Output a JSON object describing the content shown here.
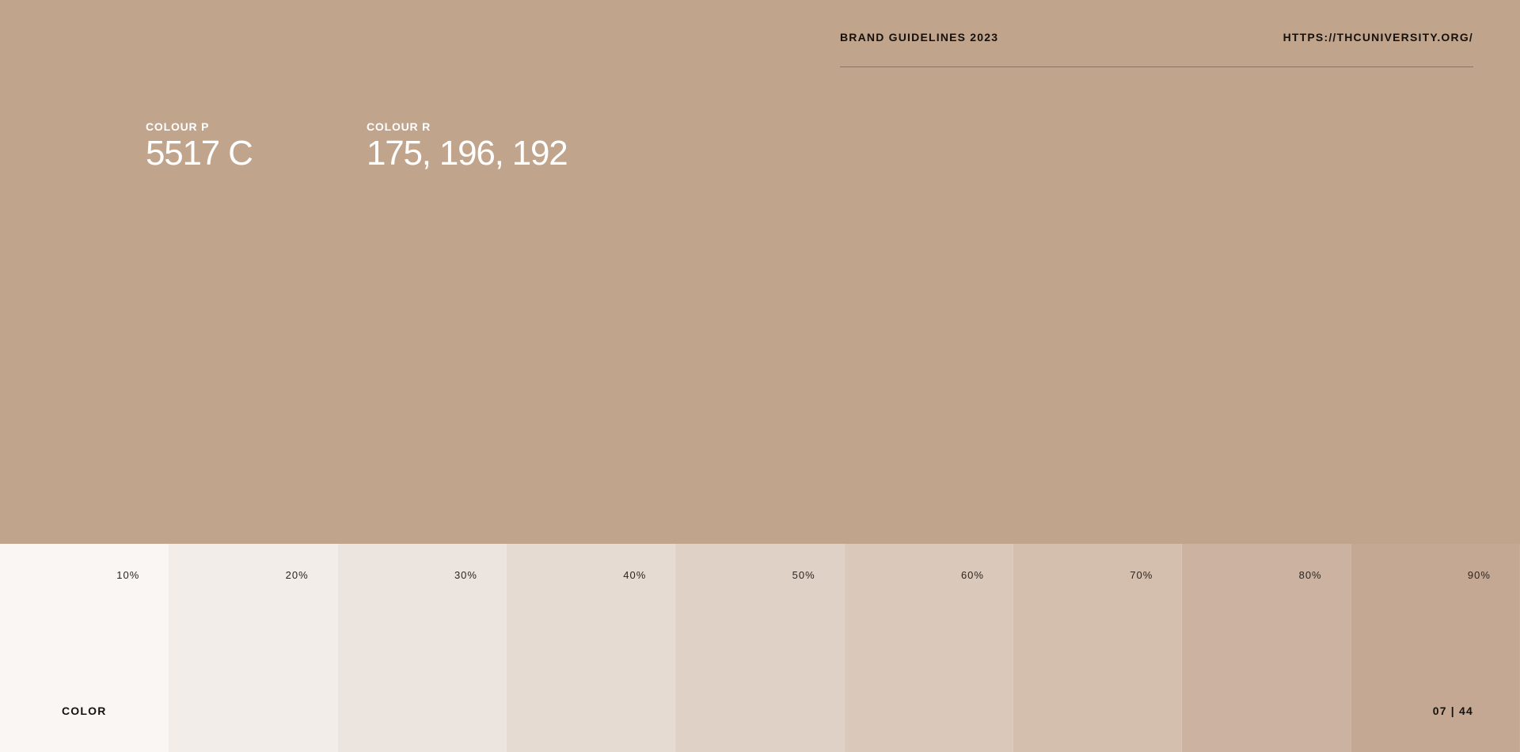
{
  "header": {
    "title": "BRAND GUIDELINES 2023",
    "url": "HTTPS://THCUNIVERSITY.ORG/"
  },
  "colour": {
    "p_label": "COLOUR P",
    "p_value": "5517 C",
    "r_label": "COLOUR R",
    "r_value": "175, 196, 192"
  },
  "swatches": [
    {
      "label": "10%",
      "color": "#f9f6f3"
    },
    {
      "label": "20%",
      "color": "#f2ede9"
    },
    {
      "label": "30%",
      "color": "#ece4df"
    },
    {
      "label": "40%",
      "color": "#e6dbd3"
    },
    {
      "label": "50%",
      "color": "#e0d1c7"
    },
    {
      "label": "60%",
      "color": "#dac8ba"
    },
    {
      "label": "70%",
      "color": "#d4bead"
    },
    {
      "label": "80%",
      "color": "#ccb2a0"
    },
    {
      "label": "90%",
      "color": "#c4a893"
    }
  ],
  "footer": {
    "section": "COLOR",
    "page": "07  | 44"
  },
  "colors": {
    "background": "#c1a48c",
    "divider": "#8d735f",
    "text_dark": "#15110d",
    "text_light": "#ffffff"
  }
}
